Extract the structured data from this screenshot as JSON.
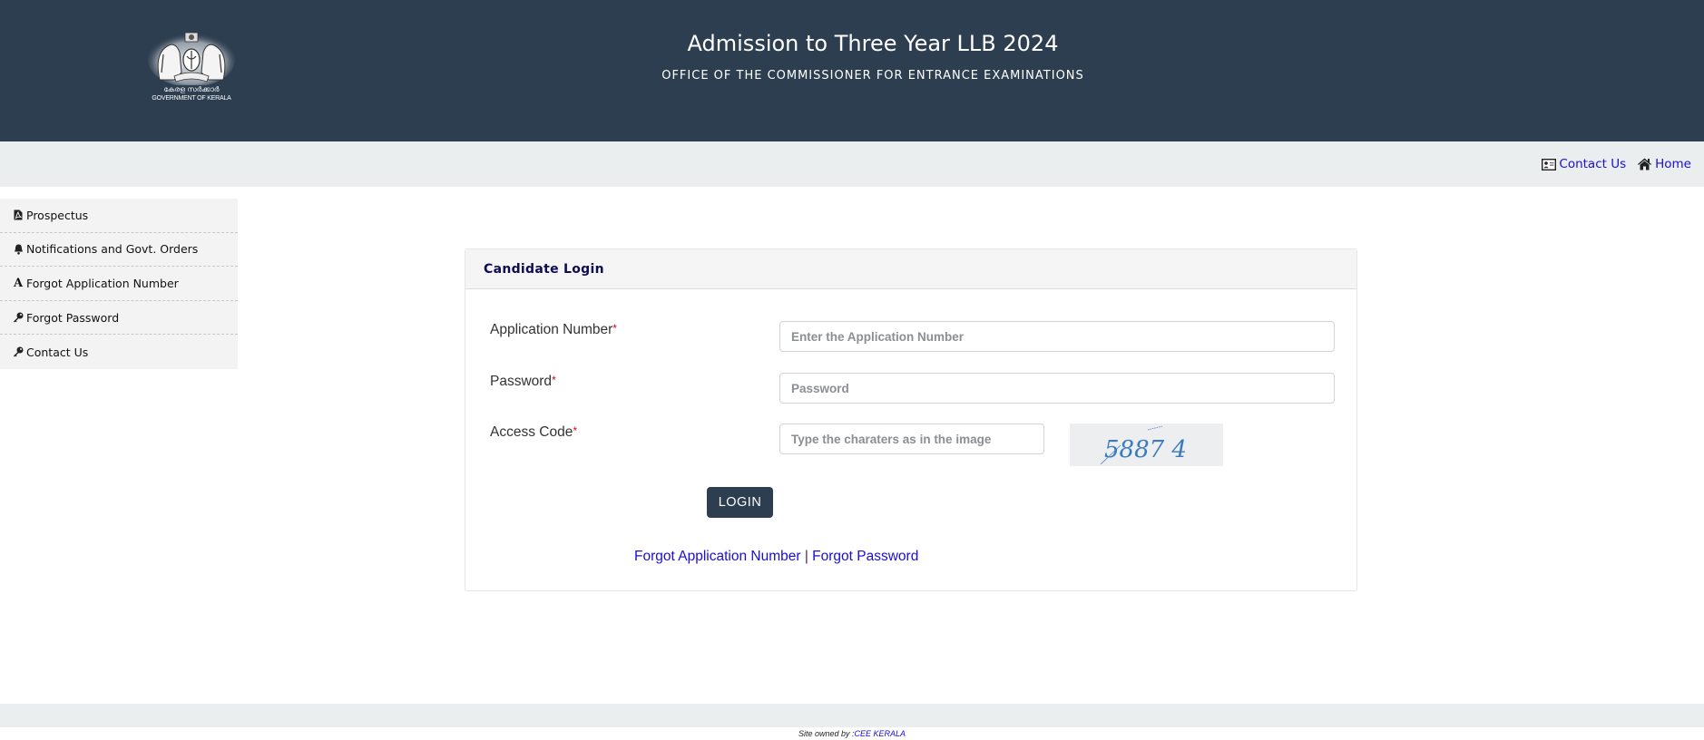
{
  "header": {
    "logo": {
      "malayalam_text": "കേരള സർക്കാർ",
      "english_text": "GOVERNMENT OF KERALA",
      "icon": "kerala-emblem-icon"
    },
    "title": "Admission to Three Year LLB 2024",
    "subtitle": "OFFICE OF THE COMMISSIONER FOR ENTRANCE EXAMINATIONS",
    "colors": {
      "background": "#2d3e50",
      "text": "#ffffff"
    }
  },
  "navbar": {
    "links": [
      {
        "label": "Contact Us",
        "icon": "contact-card-icon"
      },
      {
        "label": "Home",
        "icon": "home-icon"
      }
    ],
    "colors": {
      "background": "#eaeeef",
      "link": "#1a0dd8"
    }
  },
  "sidebar": {
    "items": [
      {
        "label": "Prospectus",
        "icon": "pdf-file-icon"
      },
      {
        "label": "Notifications and Govt. Orders",
        "icon": "bell-icon"
      },
      {
        "label": "Forgot Application Number",
        "icon": "letter-a-icon"
      },
      {
        "label": "Forgot Password",
        "icon": "key-icon"
      },
      {
        "label": "Contact Us",
        "icon": "key-icon"
      }
    ]
  },
  "login": {
    "title": "Candidate Login",
    "fields": {
      "application_number": {
        "label": "Application Number",
        "required_mark": "*",
        "placeholder": "Enter the Application Number",
        "value": ""
      },
      "password": {
        "label": "Password",
        "required_mark": "*",
        "placeholder": "Password",
        "value": ""
      },
      "access_code": {
        "label": "Access Code",
        "required_mark": "*",
        "placeholder": "Type the charaters as in the image",
        "value": ""
      }
    },
    "captcha_text": "5887 4",
    "login_button": "LOGIN",
    "links": {
      "forgot_application_number": "Forgot Application Number",
      "separator": "|",
      "forgot_password": "Forgot Password"
    },
    "colors": {
      "button": "#2d3e50",
      "title": "#0e0c52",
      "required": "#e0001a",
      "captcha_text": "#3a7bbf"
    }
  },
  "footer": {
    "prefix": "Site owned by : ",
    "owner_link": "CEE KERALA"
  }
}
